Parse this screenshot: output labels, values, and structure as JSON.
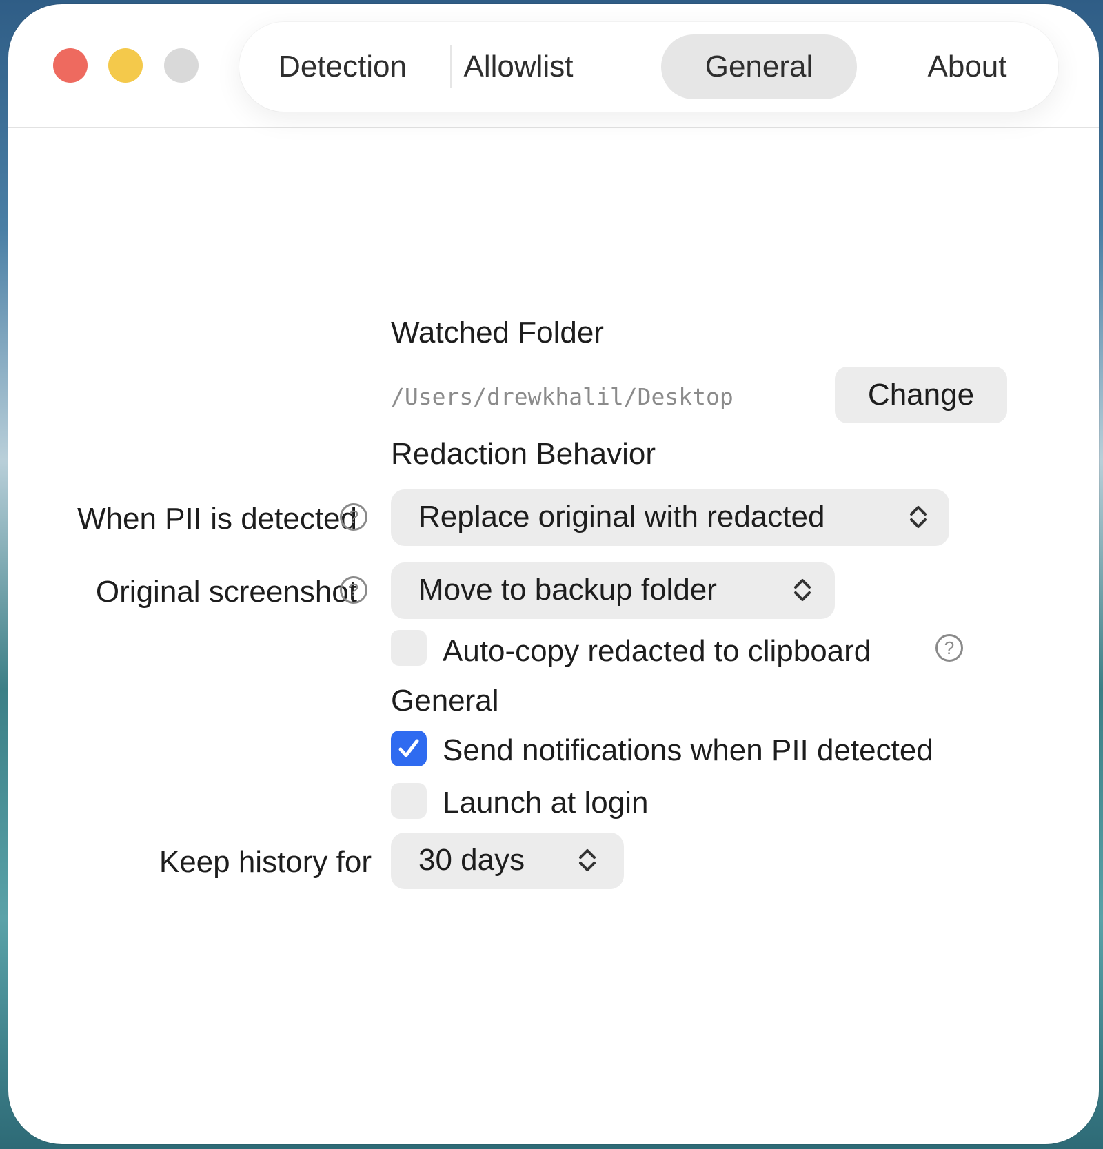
{
  "tabs": {
    "detection": "Detection",
    "allowlist": "Allowlist",
    "general": "General",
    "about": "About",
    "selected": "General"
  },
  "watched_folder": {
    "heading": "Watched Folder",
    "path": "/Users/drewkhalil/Desktop",
    "change_label": "Change"
  },
  "redaction": {
    "heading": "Redaction Behavior",
    "when_pii_label": "When PII is detected",
    "when_pii_value": "Replace original with redacted",
    "original_label": "Original screenshot",
    "original_value": "Move to backup folder",
    "autocopy_label": "Auto-copy redacted to clipboard",
    "autocopy_checked": false
  },
  "general": {
    "heading": "General",
    "notifications_label": "Send notifications when PII detected",
    "notifications_checked": true,
    "launch_label": "Launch at login",
    "launch_checked": false,
    "history_label": "Keep history for",
    "history_value": "30 days"
  },
  "colors": {
    "accent": "#2f6bf0",
    "close": "#ee6a5f",
    "minimize": "#f4c94b",
    "zoom": "#d9d9d9"
  }
}
